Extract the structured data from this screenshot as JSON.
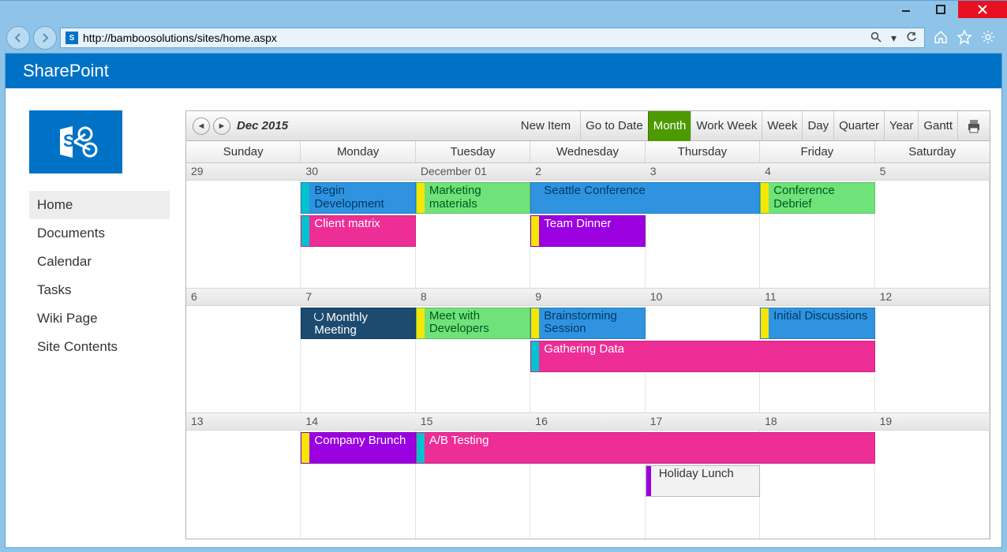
{
  "url": "http://bamboosolutions/sites/home.aspx",
  "app_title": "SharePoint",
  "sidebar_items": [
    {
      "label": "Home",
      "active": true
    },
    {
      "label": "Documents",
      "active": false
    },
    {
      "label": "Calendar",
      "active": false
    },
    {
      "label": "Tasks",
      "active": false
    },
    {
      "label": "Wiki Page",
      "active": false
    },
    {
      "label": "Site Contents",
      "active": false
    }
  ],
  "calendar": {
    "title": "Dec 2015",
    "new_item_label": "New Item",
    "views": [
      {
        "label": "Go to Date",
        "active": false
      },
      {
        "label": "Month",
        "active": true
      },
      {
        "label": "Work Week",
        "active": false
      },
      {
        "label": "Week",
        "active": false
      },
      {
        "label": "Day",
        "active": false
      },
      {
        "label": "Quarter",
        "active": false
      },
      {
        "label": "Year",
        "active": false
      },
      {
        "label": "Gantt",
        "active": false
      }
    ],
    "days_of_week": [
      "Sunday",
      "Monday",
      "Tuesday",
      "Wednesday",
      "Thursday",
      "Friday",
      "Saturday"
    ],
    "weeks": [
      {
        "days": [
          "29",
          "30",
          "December 01",
          "2",
          "3",
          "4",
          "5"
        ],
        "events": [
          {
            "label": "Begin Development",
            "row": 0,
            "start": 1,
            "span": 1,
            "color": "#2f93e0",
            "stripe": "#00c2d1",
            "textcolor": "#003a66"
          },
          {
            "label": "Marketing materials",
            "row": 0,
            "start": 2,
            "span": 1,
            "color": "#6fe27a",
            "stripe": "#f7e600",
            "textcolor": "#00591c"
          },
          {
            "label": "Seattle Conference",
            "row": 0,
            "start": 3,
            "span": 2,
            "color": "#2f93e0",
            "stripe": "#2f93e0",
            "textcolor": "#003a66"
          },
          {
            "label": "Conference Debrief",
            "row": 0,
            "start": 5,
            "span": 1,
            "color": "#6fe27a",
            "stripe": "#f7e600",
            "textcolor": "#00591c"
          },
          {
            "label": "Client matrix",
            "row": 1,
            "start": 1,
            "span": 1,
            "color": "#ed2e96",
            "stripe": "#00c2d1",
            "textcolor": "#fff"
          },
          {
            "label": "Team Dinner",
            "row": 1,
            "start": 3,
            "span": 1,
            "color": "#9b00e0",
            "stripe": "#f7e600",
            "textcolor": "#fff"
          }
        ]
      },
      {
        "days": [
          "6",
          "7",
          "8",
          "9",
          "10",
          "11",
          "12"
        ],
        "events": [
          {
            "label": "Monthly Meeting",
            "row": 0,
            "start": 1,
            "span": 1,
            "color": "#1d4b70",
            "stripe": "#1d4b70",
            "textcolor": "#fff",
            "badge": true
          },
          {
            "label": "Meet with Developers",
            "row": 0,
            "start": 2,
            "span": 1,
            "color": "#6fe27a",
            "stripe": "#f7e600",
            "textcolor": "#00591c"
          },
          {
            "label": "Brainstorming Session",
            "row": 0,
            "start": 3,
            "span": 1,
            "color": "#2f93e0",
            "stripe": "#f7e600",
            "textcolor": "#003a66"
          },
          {
            "label": "Initial Discussions",
            "row": 0,
            "start": 5,
            "span": 1,
            "color": "#2f93e0",
            "stripe": "#f7e600",
            "textcolor": "#003a66"
          },
          {
            "label": "Gathering Data",
            "row": 1,
            "start": 3,
            "span": 3,
            "color": "#ed2e96",
            "stripe": "#00c2d1",
            "textcolor": "#fff"
          }
        ]
      },
      {
        "days": [
          "13",
          "14",
          "15",
          "16",
          "17",
          "18",
          "19"
        ],
        "events": [
          {
            "label": "Company Brunch",
            "row": 0,
            "start": 1,
            "span": 1,
            "color": "#9b00e0",
            "stripe": "#f7e600",
            "textcolor": "#fff"
          },
          {
            "label": "A/B Testing",
            "row": 0,
            "start": 2,
            "span": 4,
            "color": "#ed2e96",
            "stripe": "#00c2d1",
            "textcolor": "#fff"
          },
          {
            "label": "Holiday Lunch",
            "row": 1,
            "start": 4,
            "span": 1,
            "color": "#f2f2f2",
            "stripe": "#9b00e0",
            "textcolor": "#333",
            "shortstripe": true,
            "border": "#bbb"
          }
        ]
      }
    ]
  }
}
